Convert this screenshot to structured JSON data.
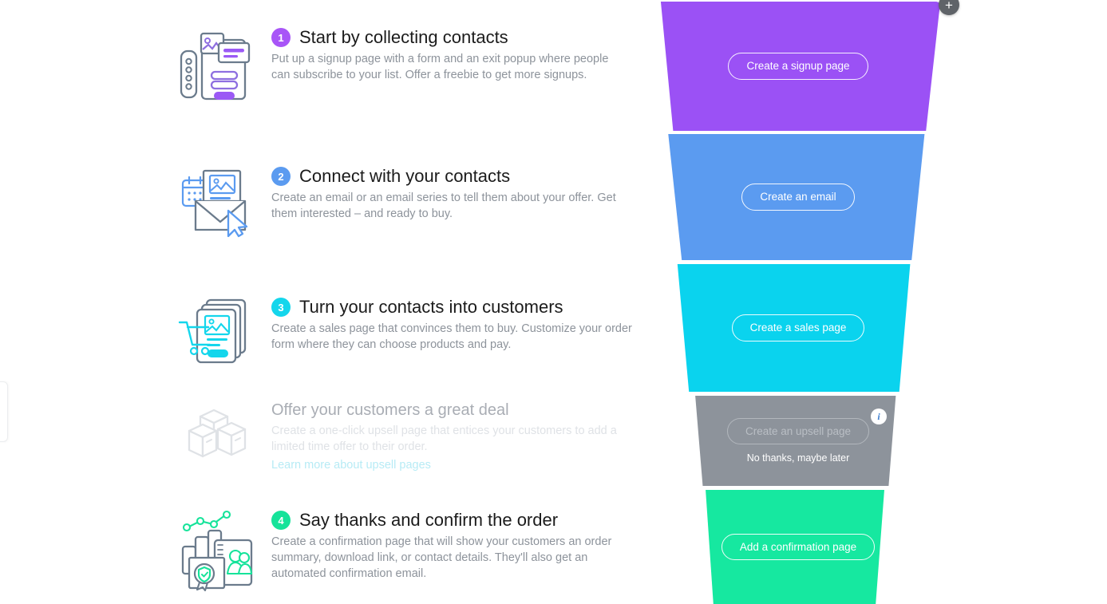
{
  "steps": [
    {
      "number": "1",
      "title": "Start by collecting contacts",
      "desc": "Put up a signup page with a form and an exit popup where people can subscribe to your list. Offer a freebie to get more signups.",
      "icon": "signup-page-icon",
      "color": "#a855f7"
    },
    {
      "number": "2",
      "title": "Connect with your contacts",
      "desc": "Create an email or an email series to tell them about your offer. Get them interested – and ready to buy.",
      "icon": "email-envelope-icon",
      "color": "#5b9bf0"
    },
    {
      "number": "3",
      "title": "Turn your contacts into customers",
      "desc": "Create a sales page that convinces them to buy. Customize your order form where they can choose products and pay.",
      "icon": "shopping-cart-pages-icon",
      "color": "#14d6ec"
    },
    {
      "number": "",
      "title": "Offer your customers a great deal",
      "desc": "Create a one-click upsell page that entices your customers to add a limited time offer to their order.",
      "link_label": "Learn more about upsell pages",
      "icon": "boxes-icon",
      "color": "#dfe2e6"
    },
    {
      "number": "4",
      "title": "Say thanks and confirm the order",
      "desc": "Create a confirmation page that will show your customers an order summary, download link, or contact details. They'll also get an automated confirmation email.",
      "icon": "confirmation-stats-icon",
      "color": "#16e39a"
    }
  ],
  "funnel": {
    "add_button_label": "+",
    "info_button_label": "i",
    "segments": [
      {
        "button_label": "Create a signup page",
        "color": "#9b51f5",
        "state": "active"
      },
      {
        "button_label": "Create an email",
        "color": "#5b9bf0",
        "state": "active"
      },
      {
        "button_label": "Create a sales page",
        "color": "#0ad3ee",
        "state": "active"
      },
      {
        "button_label": "Create an upsell page",
        "secondary_label": "No thanks, maybe later",
        "color": "#8d939b",
        "state": "disabled"
      },
      {
        "button_label": "Add a confirmation page",
        "color": "#16e8a0",
        "state": "active"
      }
    ]
  }
}
